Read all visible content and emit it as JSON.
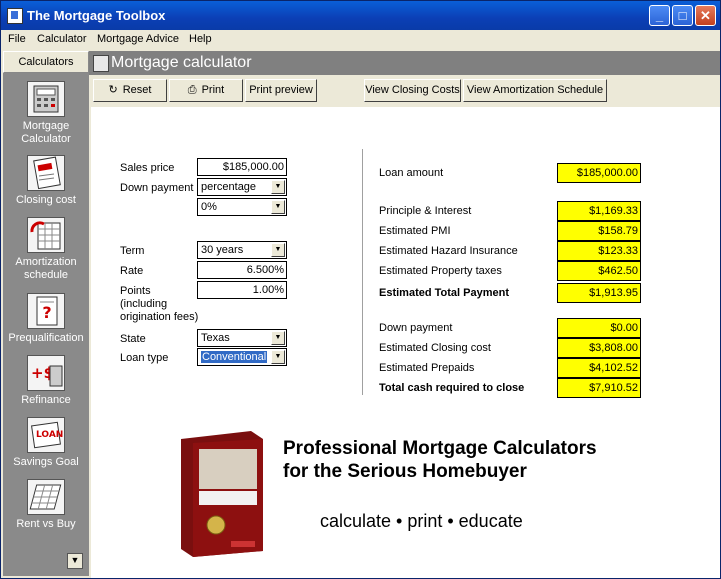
{
  "window": {
    "title": "The Mortgage Toolbox"
  },
  "menu": [
    "File",
    "Calculator",
    "Mortgage Advice",
    "Help"
  ],
  "sidebar": {
    "header": "Calculators",
    "items": [
      {
        "label": "Mortgage Calculator",
        "icon": "calculator-icon"
      },
      {
        "label": "Closing cost",
        "icon": "closing-cost-icon"
      },
      {
        "label": "Amortization schedule",
        "icon": "amortization-icon"
      },
      {
        "label": "Prequalification",
        "icon": "prequalification-icon"
      },
      {
        "label": "Refinance",
        "icon": "refinance-icon"
      },
      {
        "label": "Savings Goal",
        "icon": "savings-goal-icon"
      },
      {
        "label": "Rent vs Buy",
        "icon": "rent-vs-buy-icon"
      }
    ]
  },
  "panel": {
    "title": "Mortgage calculator"
  },
  "toolbar": {
    "reset": "Reset",
    "print": "Print",
    "print_preview": "Print preview",
    "closing_costs": "View Closing Costs",
    "amortization": "View Amortization Schedule"
  },
  "form": {
    "sales_price_label": "Sales price",
    "sales_price": "$185,000.00",
    "down_payment_label": "Down payment",
    "down_payment_mode": "percentage",
    "down_payment_value": "0%",
    "term_label": "Term",
    "term": "30 years",
    "rate_label": "Rate",
    "rate": "6.500%",
    "points_label_1": "Points",
    "points_label_2": "(including",
    "points_label_3": "origination fees)",
    "points": "1.00%",
    "state_label": "State",
    "state": "Texas",
    "loan_type_label": "Loan type",
    "loan_type": "Conventional"
  },
  "results": {
    "loan_amount_label": "Loan amount",
    "loan_amount": "$185,000.00",
    "pi_label": "Principle & Interest",
    "pi": "$1,169.33",
    "pmi_label": "Estimated PMI",
    "pmi": "$158.79",
    "hazard_label": "Estimated Hazard Insurance",
    "hazard": "$123.33",
    "tax_label": "Estimated Property taxes",
    "tax": "$462.50",
    "total_payment_label": "Estimated Total Payment",
    "total_payment": "$1,913.95",
    "down_payment_label": "Down payment",
    "down_payment": "$0.00",
    "closing_label": "Estimated Closing cost",
    "closing": "$3,808.00",
    "prepaids_label": "Estimated Prepaids",
    "prepaids": "$4,102.52",
    "cash_label": "Total cash required to close",
    "cash": "$7,910.52"
  },
  "promo": {
    "line1": "Professional Mortgage Calculators",
    "line2": "for the Serious Homebuyer",
    "tagline": "calculate • print • educate"
  },
  "colors": {
    "result_bg": "#ffff00",
    "title_bar": "#0a4fc8",
    "sidebar_bg": "#8a8a8a"
  }
}
